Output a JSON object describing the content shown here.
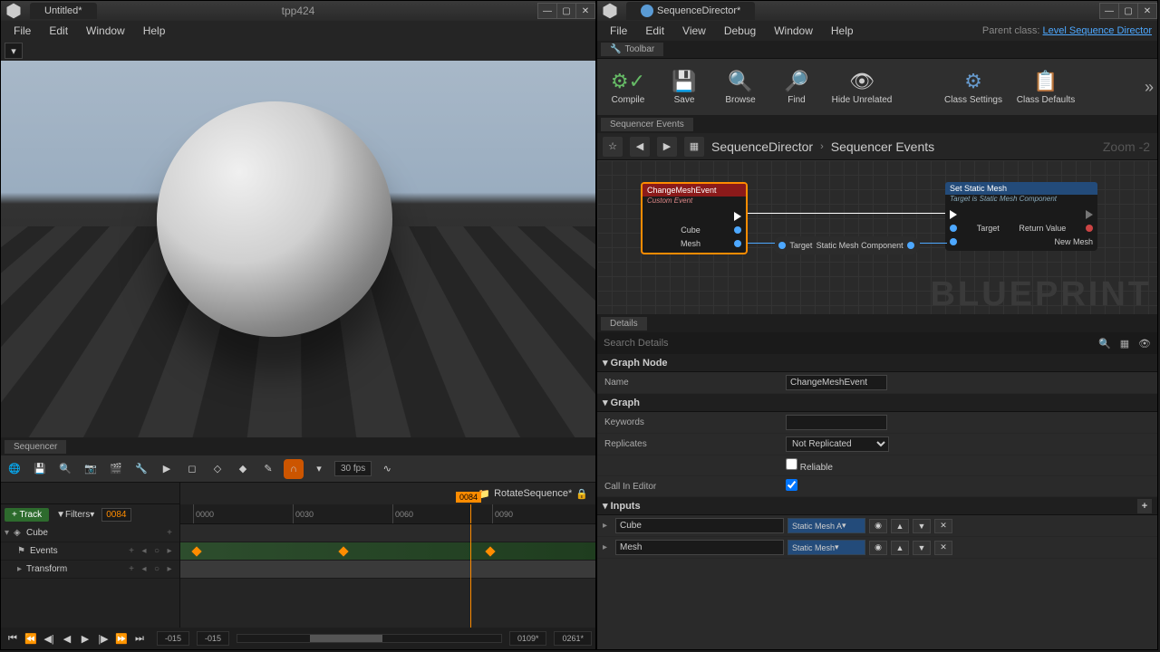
{
  "left": {
    "title": "Untitled*",
    "center": "tpp424",
    "menu": [
      "File",
      "Edit",
      "Window",
      "Help"
    ],
    "sequencer": {
      "tab": "Sequencer",
      "fps": "30 fps",
      "asset": "RotateSequence*",
      "track_btn": "+ Track",
      "filters_btn": "Filters",
      "playhead": "0084",
      "playhead_flag": "0084",
      "ticks": [
        "0000",
        "0030",
        "0060",
        "0090"
      ],
      "tracks": {
        "cube": "Cube",
        "events": "Events",
        "transform": "Transform"
      },
      "range_start": "-015",
      "range_start2": "-015",
      "range_end": "0109*",
      "range_end2": "0261*"
    }
  },
  "right": {
    "title": "SequenceDirector*",
    "menu": [
      "File",
      "Edit",
      "View",
      "Debug",
      "Window",
      "Help"
    ],
    "parent_label": "Parent class:",
    "parent_class": "Level Sequence Director",
    "toolbar_tab": "Toolbar",
    "toolbar": [
      {
        "label": "Compile",
        "icon": "⚙"
      },
      {
        "label": "Save",
        "icon": "💾"
      },
      {
        "label": "Browse",
        "icon": "🔍"
      },
      {
        "label": "Find",
        "icon": "🔎"
      },
      {
        "label": "Hide Unrelated",
        "icon": "👁"
      },
      {
        "label": "Class Settings",
        "icon": "⚙"
      },
      {
        "label": "Class Defaults",
        "icon": "📋"
      }
    ],
    "graph_tab": "Sequencer Events",
    "breadcrumb": {
      "a": "SequenceDirector",
      "b": "Sequencer Events"
    },
    "zoom": "Zoom -2",
    "watermark": "BLUEPRINT",
    "node1": {
      "title": "ChangeMeshEvent",
      "sub": "Custom Event",
      "pins": [
        "Cube",
        "Mesh"
      ]
    },
    "node2": {
      "in": "Target",
      "label": "Static Mesh Component"
    },
    "node3": {
      "title": "Set Static Mesh",
      "sub": "Target is Static Mesh Component",
      "pins_in": [
        "Target",
        "New Mesh"
      ],
      "pins_out": [
        "Return Value"
      ]
    },
    "details": {
      "tab": "Details",
      "search_ph": "Search Details",
      "sections": {
        "graph_node": "Graph Node",
        "graph": "Graph",
        "inputs": "Inputs"
      },
      "name_label": "Name",
      "name_value": "ChangeMeshEvent",
      "keywords_label": "Keywords",
      "keywords_value": "",
      "replicates_label": "Replicates",
      "replicates_value": "Not Replicated",
      "reliable_label": "Reliable",
      "callineditor_label": "Call In Editor",
      "inputs": [
        {
          "name": "Cube",
          "type": "Static Mesh A"
        },
        {
          "name": "Mesh",
          "type": "Static Mesh"
        }
      ]
    }
  }
}
